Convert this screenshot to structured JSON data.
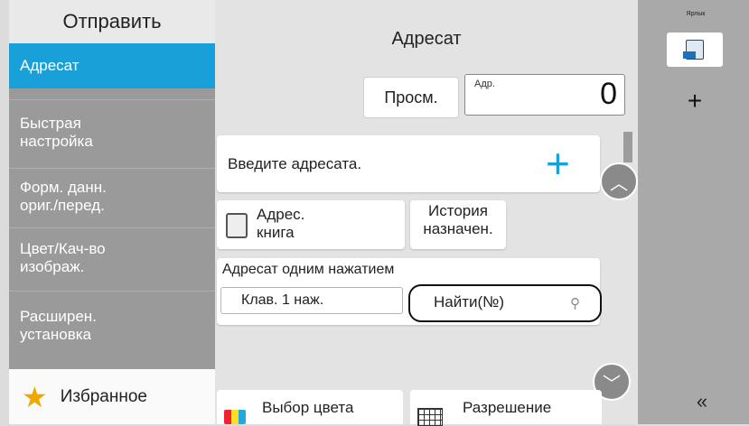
{
  "left_panel": {
    "header": "Отправить",
    "items": [
      {
        "label": "Адресат",
        "active": true
      },
      {
        "label": "Быстрая\nнастройка",
        "active": false
      },
      {
        "label": "Форм. данн.\nориг./перед.",
        "active": false
      },
      {
        "label": "Цвет/Кач-во\nизображ.",
        "active": false
      },
      {
        "label": "Расширен.\nустановка",
        "active": false
      }
    ],
    "favorites": "Избранное"
  },
  "main": {
    "title": "Адресат",
    "view_button": "Просм.",
    "addr_label": "Адр.",
    "addr_count": "0",
    "enter_destination": "Введите адресата.",
    "address_book": "Адрес.\nкнига",
    "history": "История\nназначен.",
    "one_touch_label": "Адресат одним нажатием",
    "one_touch_key": "Клав. 1 наж.",
    "find": "Найти(№)",
    "color_select": "Выбор цвета",
    "resolution": "Разрешение"
  },
  "right_panel": {
    "shortcut_label": "Ярлык",
    "add": "+",
    "collapse": "«"
  },
  "colors": {
    "accent": "#1aa0d8",
    "left_bg": "#9a9a9a",
    "right_bg": "#a9a9a9"
  }
}
